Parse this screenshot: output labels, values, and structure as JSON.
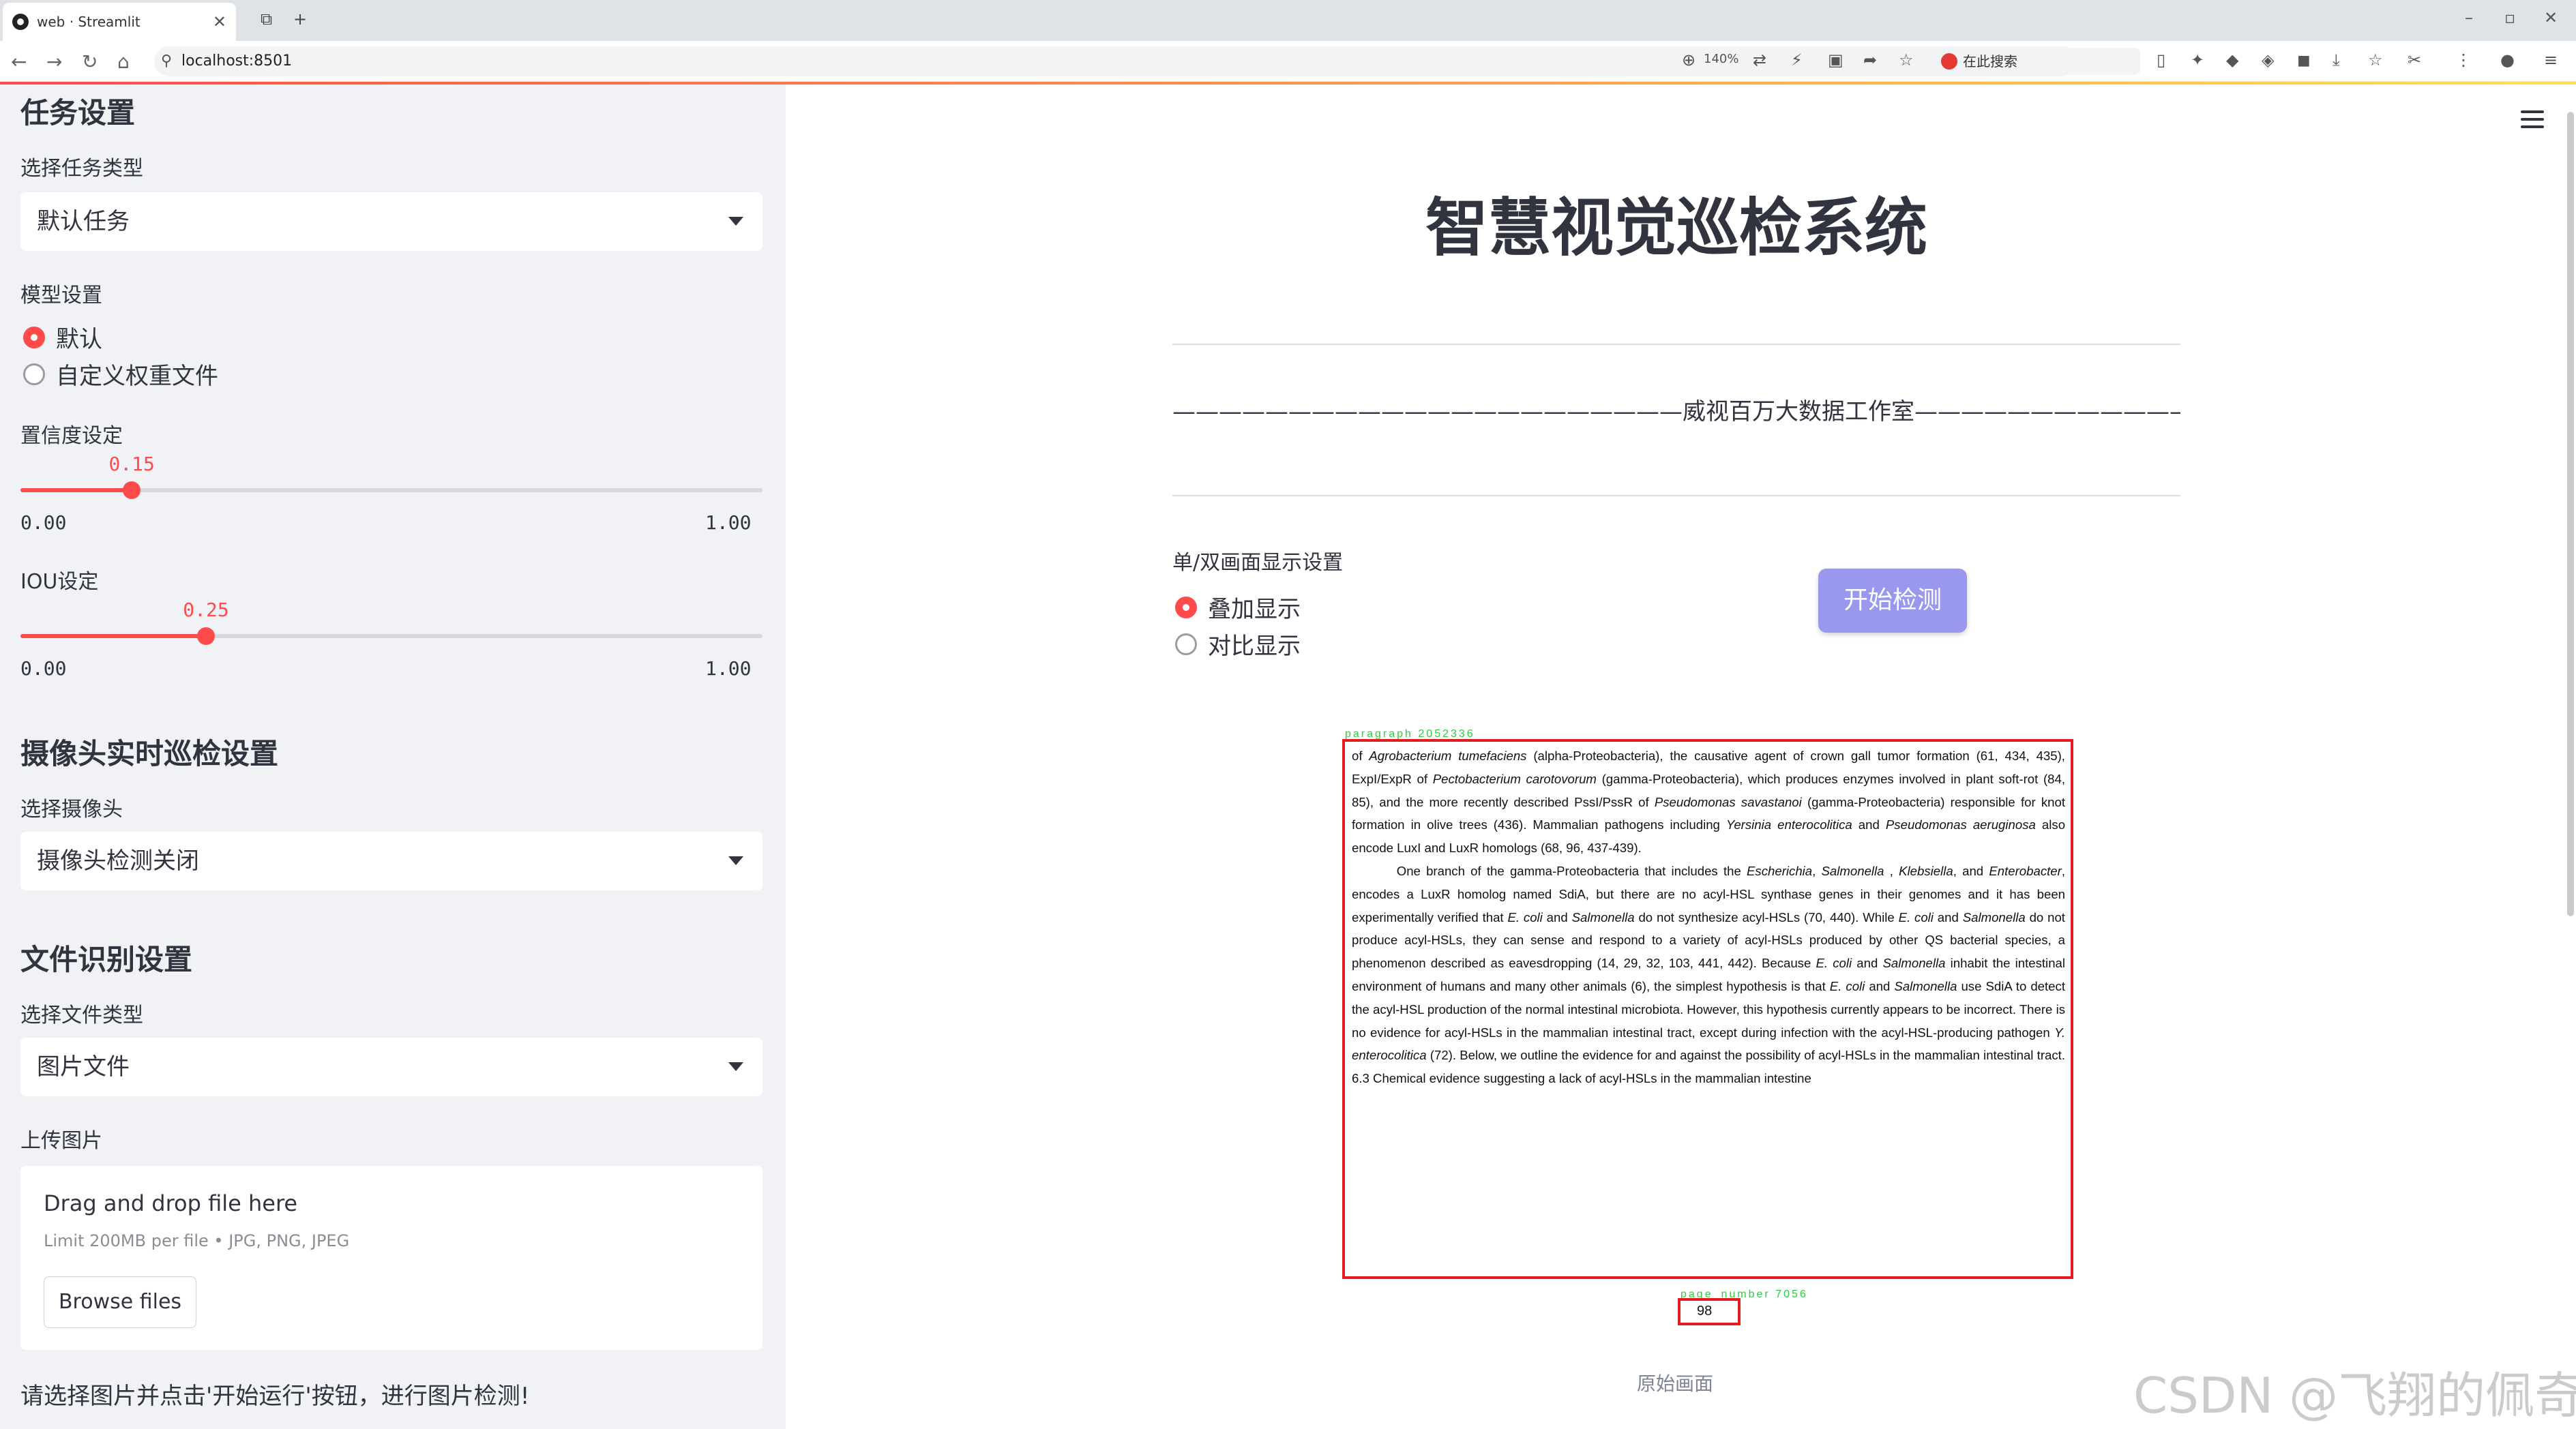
{
  "browser": {
    "tab_title": "web · Streamlit",
    "url": "localhost:8501",
    "zoom": "140%",
    "search_placeholder": "在此搜索"
  },
  "sidebar": {
    "task_section": "任务设置",
    "task_type_label": "选择任务类型",
    "task_type_value": "默认任务",
    "model_label": "模型设置",
    "model_options": [
      "默认",
      "自定义权重文件"
    ],
    "model_selected": "默认",
    "conf_label": "置信度设定",
    "conf_value": "0.15",
    "conf_level": 0.15,
    "conf_min": "0.00",
    "conf_max": "1.00",
    "iou_label": "IOU设定",
    "iou_value": "0.25",
    "iou_level": 0.25,
    "iou_min": "0.00",
    "iou_max": "1.00",
    "camera_section": "摄像头实时巡检设置",
    "camera_label": "选择摄像头",
    "camera_value": "摄像头检测关闭",
    "file_section": "文件识别设置",
    "file_type_label": "选择文件类型",
    "file_type_value": "图片文件",
    "upload_label": "上传图片",
    "upload_title": "Drag and drop file here",
    "upload_limit": "Limit 200MB per file • JPG, PNG, JPEG",
    "browse_label": "Browse files",
    "note": "请选择图片并点击'开始运行'按钮，进行图片检测!"
  },
  "main": {
    "title": "智慧视觉巡检系统",
    "studio_line": "——————————————————————威视百万大数据工作室———————————————————————",
    "display_label": "单/双画面显示设置",
    "display_options": [
      "叠加显示",
      "对比显示"
    ],
    "display_selected": "叠加显示",
    "start_button": "开始检测",
    "caption": "原始画面"
  },
  "result": {
    "para_label": "paragraph  2052336",
    "pagenum_label": "page_number  7056",
    "page_number": "98",
    "box_color": "#e11d1d",
    "label_color": "#2ecc40"
  },
  "watermark": "CSDN @飞翔的佩奇"
}
